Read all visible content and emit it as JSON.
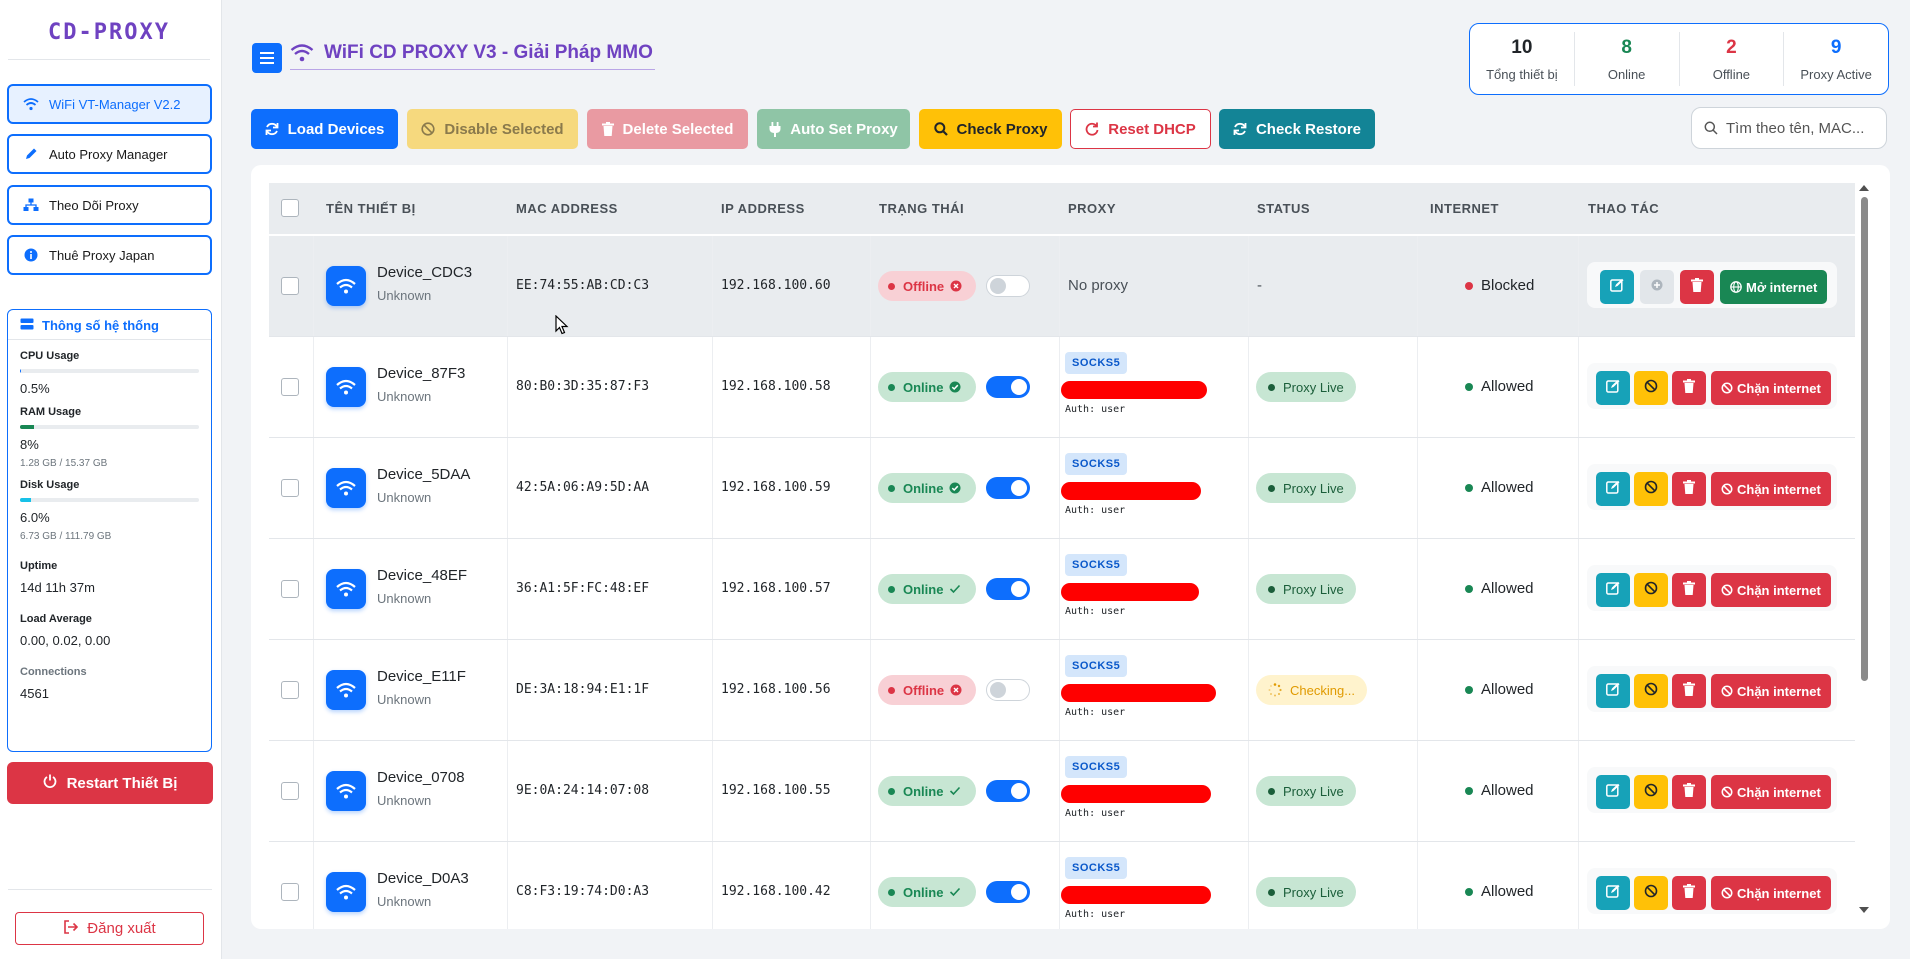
{
  "sidebar": {
    "brand": "CD-PROXY",
    "nav": [
      {
        "label": "WiFi VT-Manager V2.2",
        "icon": "wifi-icon",
        "active": true
      },
      {
        "label": "Auto Proxy Manager",
        "icon": "pencil-icon",
        "active": false
      },
      {
        "label": "Theo Dõi Proxy",
        "icon": "network-icon",
        "active": false
      },
      {
        "label": "Thuê Proxy Japan",
        "icon": "info-icon",
        "active": false
      }
    ],
    "system": {
      "title": "Thông số hệ thống",
      "cpu_label": "CPU Usage",
      "cpu_value": "0.5%",
      "cpu_percent": 0.5,
      "ram_label": "RAM Usage",
      "ram_value": "8%",
      "ram_percent": 8,
      "ram_detail": "1.28 GB / 15.37 GB",
      "disk_label": "Disk Usage",
      "disk_value": "6.0%",
      "disk_percent": 6,
      "disk_detail": "6.73 GB / 111.79 GB",
      "uptime_label": "Uptime",
      "uptime_value": "14d 11h 37m",
      "load_label": "Load Average",
      "load_value": "0.00, 0.02, 0.00",
      "conn_label": "Connections",
      "conn_value": "4561"
    },
    "restart_label": "Restart Thiết Bị",
    "logout_label": "Đăng xuất"
  },
  "header": {
    "title": "WiFi CD PROXY V3 - Giải Pháp MMO"
  },
  "stats": [
    {
      "value": "10",
      "label": "Tổng thiết bị",
      "color": "#212529"
    },
    {
      "value": "8",
      "label": "Online",
      "color": "#198754"
    },
    {
      "value": "2",
      "label": "Offline",
      "color": "#dc3545"
    },
    {
      "value": "9",
      "label": "Proxy Active",
      "color": "#0d6efd"
    }
  ],
  "toolbar": {
    "load": "Load Devices",
    "disable": "Disable Selected",
    "delete": "Delete Selected",
    "auto": "Auto Set Proxy",
    "check": "Check Proxy",
    "reset": "Reset DHCP",
    "restore": "Check Restore",
    "search_placeholder": "Tìm theo tên, MAC..."
  },
  "colors": {
    "primary": "#0d6efd",
    "brand": "#6f42c1",
    "success": "#198754",
    "danger": "#dc3545",
    "warning": "#ffc107",
    "info": "#17a2b8"
  },
  "table": {
    "headers": {
      "name": "TÊN THIẾT BỊ",
      "mac": "MAC ADDRESS",
      "ip": "IP ADDRESS",
      "state": "TRẠNG THÁI",
      "proxy": "PROXY",
      "status": "STATUS",
      "internet": "INTERNET",
      "actions": "THAO TÁC"
    },
    "rows": [
      {
        "name": "Device_CDC3",
        "sub": "Unknown",
        "mac": "EE:74:55:AB:CD:C3",
        "ip": "192.168.100.60",
        "state": "Offline",
        "online": false,
        "proxy_type": "",
        "proxy_text": "No proxy",
        "auth": "",
        "status": "-",
        "status_kind": "none",
        "internet": "Blocked",
        "internet_ok": false,
        "action_label": "Mở internet"
      },
      {
        "name": "Device_87F3",
        "sub": "Unknown",
        "mac": "80:B0:3D:35:87:F3",
        "ip": "192.168.100.58",
        "state": "Online",
        "online": true,
        "proxy_type": "SOCKS5",
        "proxy_text": "",
        "auth": "Auth: user",
        "status": "Proxy Live",
        "status_kind": "live",
        "internet": "Allowed",
        "internet_ok": true,
        "action_label": "Chặn internet"
      },
      {
        "name": "Device_5DAA",
        "sub": "Unknown",
        "mac": "42:5A:06:A9:5D:AA",
        "ip": "192.168.100.59",
        "state": "Online",
        "online": true,
        "proxy_type": "SOCKS5",
        "proxy_text": "",
        "auth": "Auth: user",
        "status": "Proxy Live",
        "status_kind": "live",
        "internet": "Allowed",
        "internet_ok": true,
        "action_label": "Chặn internet"
      },
      {
        "name": "Device_48EF",
        "sub": "Unknown",
        "mac": "36:A1:5F:FC:48:EF",
        "ip": "192.168.100.57",
        "state": "Online",
        "online": true,
        "proxy_type": "SOCKS5",
        "proxy_text": "",
        "auth": "Auth: user",
        "status": "Proxy Live",
        "status_kind": "live",
        "internet": "Allowed",
        "internet_ok": true,
        "action_label": "Chặn internet"
      },
      {
        "name": "Device_E11F",
        "sub": "Unknown",
        "mac": "DE:3A:18:94:E1:1F",
        "ip": "192.168.100.56",
        "state": "Offline",
        "online": false,
        "proxy_type": "SOCKS5",
        "proxy_text": "",
        "auth": "Auth: user",
        "status": "Checking...",
        "status_kind": "checking",
        "internet": "Allowed",
        "internet_ok": true,
        "action_label": "Chặn internet"
      },
      {
        "name": "Device_0708",
        "sub": "Unknown",
        "mac": "9E:0A:24:14:07:08",
        "ip": "192.168.100.55",
        "state": "Online",
        "online": true,
        "proxy_type": "SOCKS5",
        "proxy_text": "",
        "auth": "Auth: user",
        "status": "Proxy Live",
        "status_kind": "live",
        "internet": "Allowed",
        "internet_ok": true,
        "action_label": "Chặn internet"
      },
      {
        "name": "Device_D0A3",
        "sub": "Unknown",
        "mac": "C8:F3:19:74:D0:A3",
        "ip": "192.168.100.42",
        "state": "Online",
        "online": true,
        "proxy_type": "SOCKS5",
        "proxy_text": "",
        "auth": "Auth: user",
        "status": "Proxy Live",
        "status_kind": "live",
        "internet": "Allowed",
        "internet_ok": true,
        "action_label": "Chặn internet"
      }
    ]
  }
}
